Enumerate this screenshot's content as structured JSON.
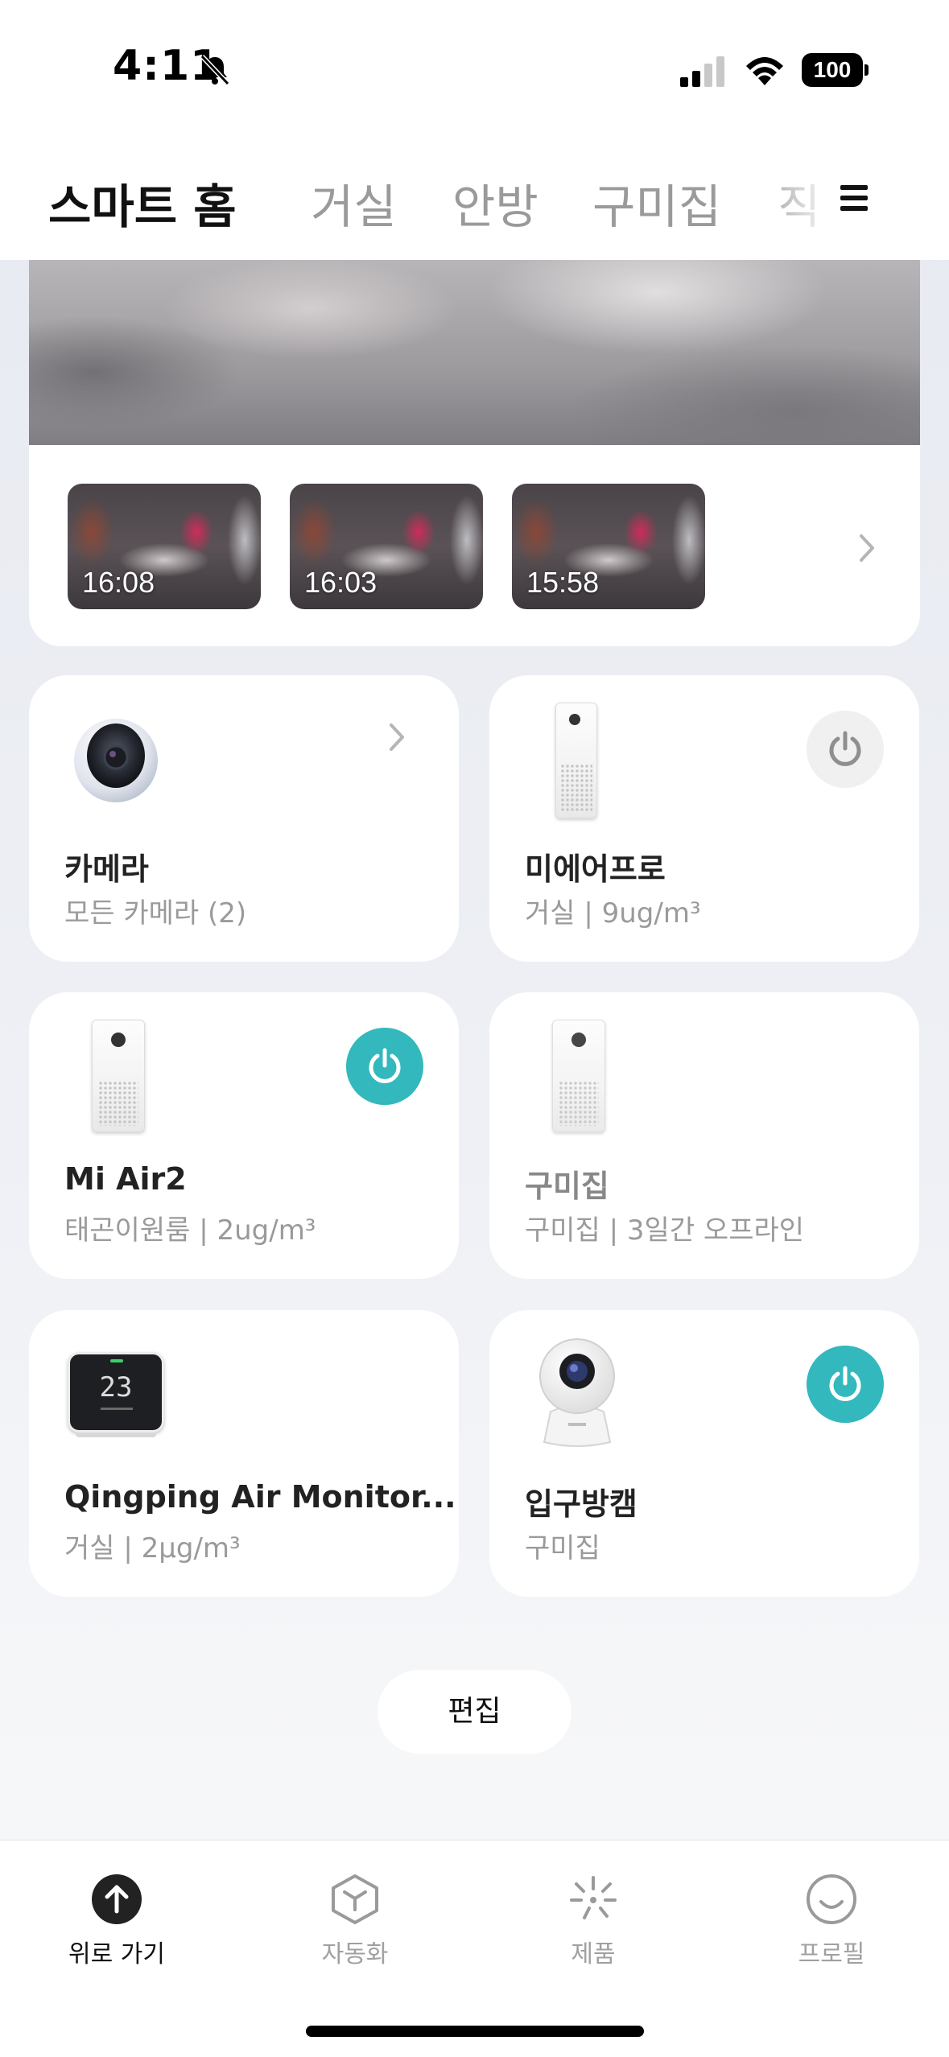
{
  "status_bar": {
    "time": "4:11",
    "battery": "100"
  },
  "tabs": [
    {
      "label": "스마트 홈",
      "active": true
    },
    {
      "label": "거실",
      "active": false
    },
    {
      "label": "안방",
      "active": false
    },
    {
      "label": "구미집",
      "active": false
    },
    {
      "label": "직",
      "active": false
    }
  ],
  "camera_card": {
    "thumbnails": [
      {
        "time": "16:08"
      },
      {
        "time": "16:03"
      },
      {
        "time": "15:58"
      }
    ]
  },
  "devices": [
    {
      "name": "카메라",
      "sub": "모든 카메라 (2)",
      "icon": "camera-icon",
      "control": "chevron"
    },
    {
      "name": "미에어프로",
      "sub": "거실 | 9ug/m³",
      "icon": "air-purifier-icon",
      "control": "power-off"
    },
    {
      "name": "Mi Air2",
      "sub": "태곤이원룸 | 2ug/m³",
      "icon": "air-purifier-icon",
      "control": "power-on"
    },
    {
      "name": "구미집",
      "sub": "구미집 | 3일간 오프라인",
      "icon": "air-purifier-icon",
      "control": "none",
      "offline": true
    },
    {
      "name": "Qingping Air Monitor...",
      "sub": "거실 | 2μg/m³",
      "icon": "air-monitor-icon",
      "control": "none",
      "monitor_display": "23"
    },
    {
      "name": "입구방캠",
      "sub": "구미집",
      "icon": "security-camera-icon",
      "control": "power-on"
    }
  ],
  "edit_button": "편집",
  "bottom_nav": [
    {
      "label": "위로 가기",
      "icon": "arrow-up-icon",
      "active": true
    },
    {
      "label": "자동화",
      "icon": "cube-icon",
      "active": false
    },
    {
      "label": "제품",
      "icon": "sparkle-icon",
      "active": false
    },
    {
      "label": "프로필",
      "icon": "smile-icon",
      "active": false
    }
  ],
  "colors": {
    "accent": "#32b8bd",
    "background": "#eef0f5",
    "card": "#ffffff"
  }
}
